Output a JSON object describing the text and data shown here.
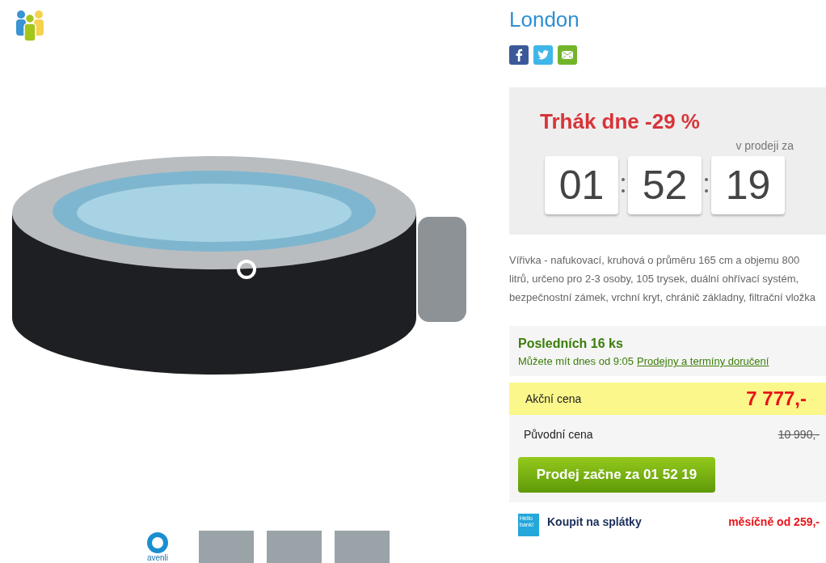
{
  "product": {
    "title": "London",
    "brand_thumb_text": "avenli",
    "thumbnails": [
      {
        "selected": false
      },
      {
        "selected": false
      },
      {
        "selected": false
      }
    ]
  },
  "share": [
    {
      "kind": "facebook"
    },
    {
      "kind": "twitter"
    },
    {
      "kind": "email"
    }
  ],
  "deal": {
    "title": "Trhák dne -29 %",
    "caption": "v prodeji za",
    "timer": [
      "01",
      "52",
      "19"
    ]
  },
  "description": "Vířivka - nafukovací, kruhová o průměru 165 cm a objemu 800 litrů, určeno pro 2-3 osoby, 105 trysek, duální ohřívací systém, bezpečnostní zámek, vrchní kryt, chránič základny, filtrační vložka",
  "stock": {
    "title": "Posledních 16 ks",
    "text": "Můžete mít dnes od 9:05",
    "link": "Prodejny a termíny doručení"
  },
  "prices": [
    {
      "label": "Akční cena",
      "value": "7 777,-",
      "kind": "sale"
    },
    {
      "label": "Původní cena",
      "value": "10 990,-",
      "kind": "original"
    }
  ],
  "button": "Prodej začne za 01 52 19",
  "installment": {
    "logo": "Hello bank!",
    "title": "Koupit na splátky",
    "price": "měsíčně od 259,-"
  }
}
